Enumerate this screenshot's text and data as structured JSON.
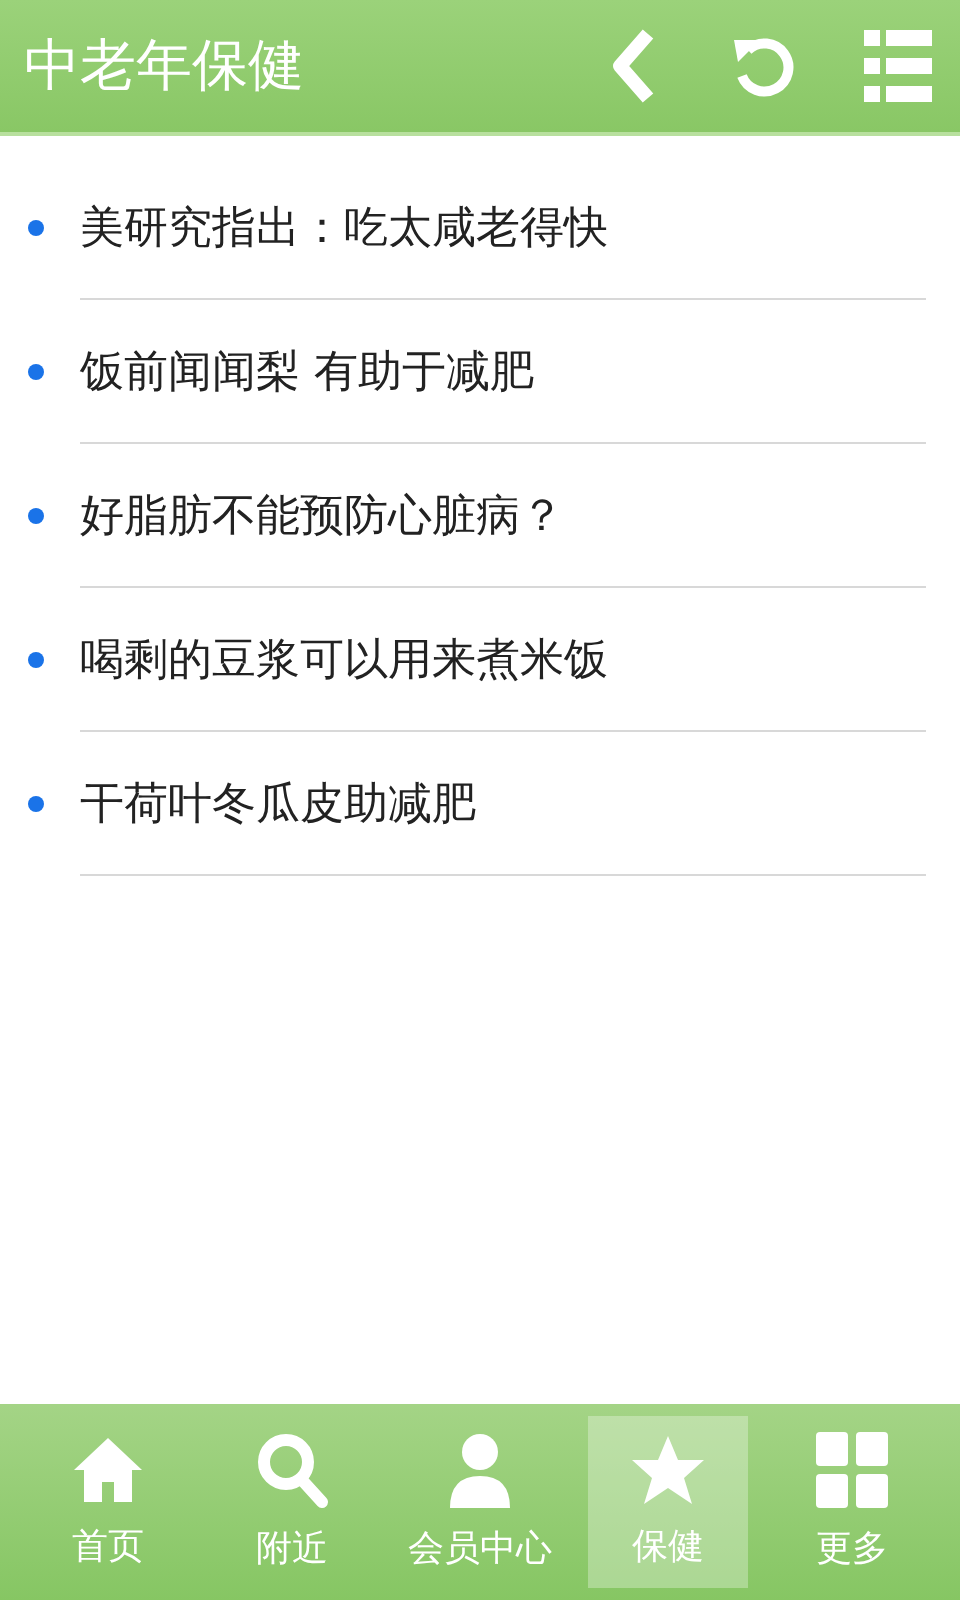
{
  "header": {
    "title": "中老年保健"
  },
  "articles": [
    {
      "title": "美研究指出：吃太咸老得快"
    },
    {
      "title": "饭前闻闻梨 有助于减肥"
    },
    {
      "title": "好脂肪不能预防心脏病？"
    },
    {
      "title": "喝剩的豆浆可以用来煮米饭"
    },
    {
      "title": "干荷叶冬瓜皮助减肥"
    }
  ],
  "bottom_nav": [
    {
      "label": "首页",
      "selected": false
    },
    {
      "label": "附近",
      "selected": false
    },
    {
      "label": "会员中心",
      "selected": false
    },
    {
      "label": "保健",
      "selected": true
    },
    {
      "label": "更多",
      "selected": false
    }
  ]
}
